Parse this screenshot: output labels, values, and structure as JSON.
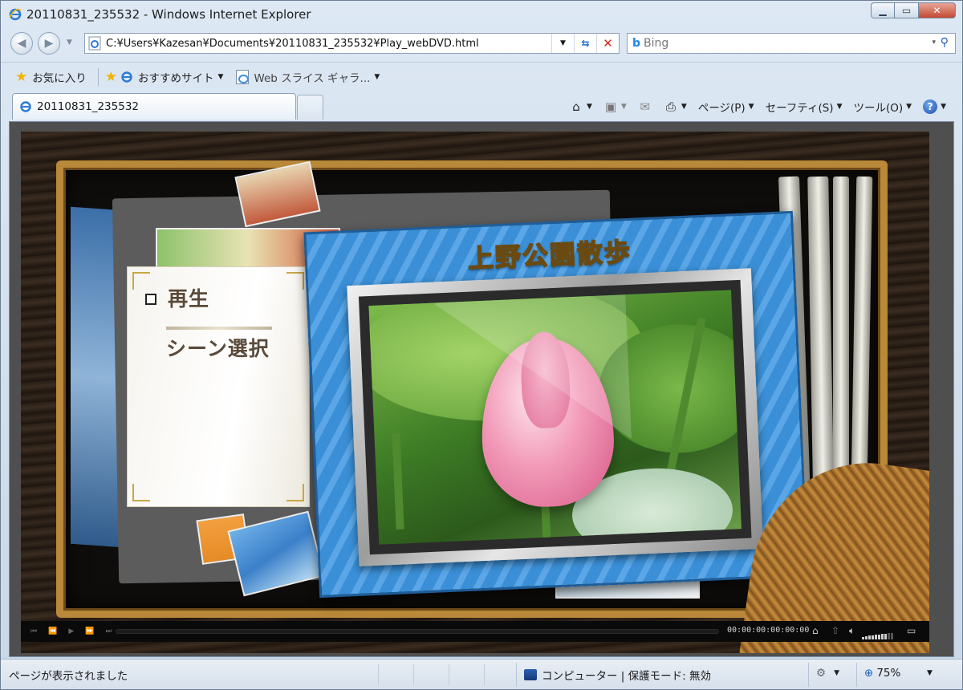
{
  "window": {
    "title": "20110831_235532 - Windows Internet Explorer",
    "min_icon": "minimize-icon",
    "max_icon": "maximize-icon",
    "close_icon": "close-icon"
  },
  "address_bar": {
    "url": "C:¥Users¥Kazesan¥Documents¥20110831_235532¥Play_webDVD.html"
  },
  "search": {
    "placeholder": "Bing",
    "provider": "b"
  },
  "favorites_bar": {
    "favorites_label": "お気に入り",
    "suggested_sites": "おすすめサイト",
    "web_slice_gallery": "Web スライス ギャラ..."
  },
  "tabs": [
    {
      "label": "20110831_235532",
      "active": true
    }
  ],
  "command_bar": {
    "page": "ページ(P)",
    "safety": "セーフティ(S)",
    "tools": "ツール(O)"
  },
  "dvd_menu": {
    "title": "上野公園散歩",
    "items": [
      {
        "label": "再生",
        "selected": true
      },
      {
        "label": "シーン選択",
        "selected": false
      }
    ]
  },
  "player": {
    "timecode": "00:00:00:00:00:00",
    "volume_level": 0.85
  },
  "status_bar": {
    "status_text": "ページが表示されました",
    "zone_text": "コンピューター | 保護モード: 無効",
    "zoom": "75%"
  },
  "colors": {
    "accent_blue": "#3a8fd6",
    "title_gold": "#f2c64a",
    "frame_gold": "#b98838"
  }
}
